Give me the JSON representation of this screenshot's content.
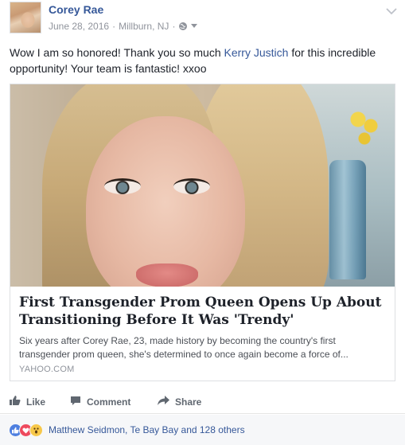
{
  "post": {
    "author": "Corey Rae",
    "date": "June 28, 2016",
    "separator": "·",
    "location": "Millburn, NJ",
    "separator2": "·",
    "status_before": "Wow I am so honored! Thank you so much ",
    "status_mention": "Kerry Justich",
    "status_after": " for this incredible opportunity! Your team is fantastic! xxoo"
  },
  "link_card": {
    "title": "First Transgender Prom Queen Opens Up About Transitioning Before It Was 'Trendy'",
    "description": "Six years after Corey Rae, 23, made history by becoming the country's first transgender prom queen, she's determined to once again become a force of...",
    "domain": "YAHOO.COM"
  },
  "actions": {
    "like_label": "Like",
    "comment_label": "Comment",
    "share_label": "Share"
  },
  "reactions": {
    "summary": "Matthew Seidmon, Te Bay Bay and 128 others",
    "types": [
      "like-reaction-icon",
      "love-reaction-icon",
      "wow-reaction-icon"
    ]
  },
  "colors": {
    "link_blue": "#365899",
    "meta_gray": "#90949c",
    "action_gray": "#606770",
    "reaction_bar_bg": "#f6f7f9"
  }
}
